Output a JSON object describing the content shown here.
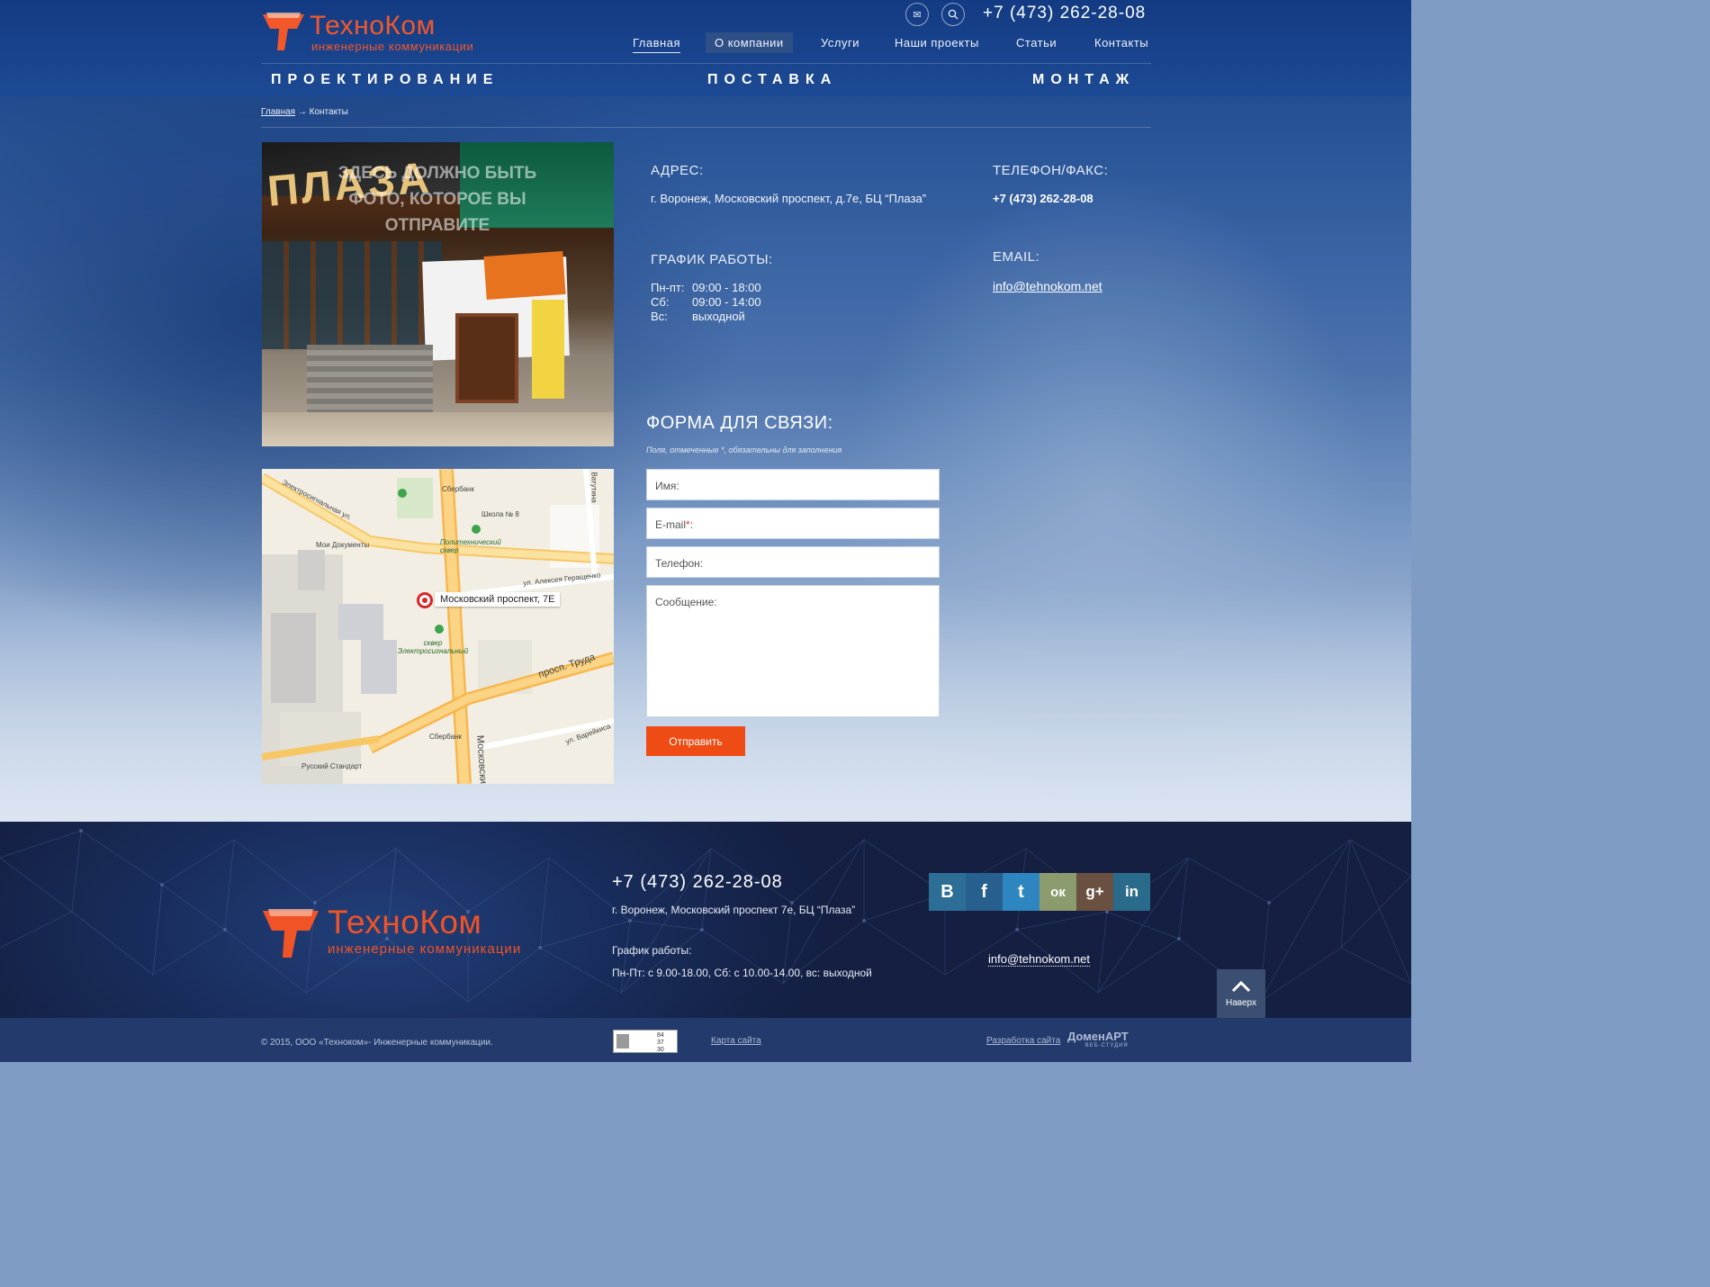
{
  "header": {
    "logo_title": "ТехноКом",
    "logo_subtitle": "инженерные коммуникации",
    "phone": "+7 (473) 262-28-08",
    "icons": {
      "mail": "mail-icon",
      "search": "search-icon"
    },
    "nav": [
      "Главная",
      "О компании",
      "Услуги",
      "Наши проекты",
      "Статьи",
      "Контакты"
    ],
    "services": [
      "ПРОЕКТИРОВАНИЕ",
      "ПОСТАВКА",
      "МОНТАЖ"
    ]
  },
  "breadcrumb": {
    "home": "Главная",
    "separator": "→",
    "current": "Контакты"
  },
  "photo": {
    "note": "ЗДЕСЬ ДОЛЖНО БЫТЬ ФОТО, КОТОРОЕ ВЫ ОТПРАВИТЕ"
  },
  "map": {
    "marker_label": "Московский проспект, 7Е",
    "labels": {
      "street1": "Электросигнальная ул.",
      "street2": "ул. Алексея Геращенко",
      "street3": "просп. Труда",
      "street4": "ул. Варейкиса",
      "street5": "Московский",
      "street6": "Ватутина",
      "poi1": "Сбербанк",
      "poi2": "Школа № 8",
      "poi3": "Мои Документы",
      "poi4": "Политехнический сквер",
      "poi5": "сквер Электросигнальный",
      "poi6": "Сбербанк",
      "poi7": "Русский Стандарт"
    }
  },
  "contacts": {
    "address_title": "АДРЕС:",
    "address": "г. Воронеж, Московский проспект, д.7е, БЦ “Плаза”",
    "phone_title": "ТЕЛЕФОН/ФАКС:",
    "phone": "+7 (473) 262-28-08",
    "hours_title": "ГРАФИК РАБОТЫ:",
    "hours": [
      {
        "day": "Пн-пт:",
        "time": "09:00 - 18:00"
      },
      {
        "day": "Сб:",
        "time": "09:00 - 14:00"
      },
      {
        "day": "Вс:",
        "time": "выходной"
      }
    ],
    "email_title": "EMAIL:",
    "email": "info@tehnokom.net"
  },
  "form": {
    "title": "ФОРМА ДЛЯ СВЯЗИ:",
    "note": "Поля, отмеченные *, обязательны для заполнения",
    "name_label": "Имя:",
    "email_label": "E-mail",
    "email_required": "*",
    "email_suffix": ":",
    "phone_label": "Телефон:",
    "message_label": "Сообщение:",
    "submit": "Отправить"
  },
  "footer": {
    "logo_title": "ТехноКом",
    "logo_subtitle": "инженерные коммуникации",
    "phone": "+7 (473) 262-28-08",
    "address": "г. Воронеж, Московский проспект 7е, БЦ “Плаза”",
    "hours_title": "График работы:",
    "hours": "Пн-Пт: с 9.00-18.00, Сб: с 10.00-14.00, вс: выходной",
    "email": "info@tehnokom.net",
    "social": [
      {
        "name": "vk-icon",
        "glyph": "В",
        "color": "#2c6e96"
      },
      {
        "name": "facebook-icon",
        "glyph": "f",
        "color": "#275f8f"
      },
      {
        "name": "twitter-icon",
        "glyph": "t",
        "color": "#2e86c0"
      },
      {
        "name": "odnoklassniki-icon",
        "glyph": "ок",
        "color": "#8b9b6d"
      },
      {
        "name": "google-plus-icon",
        "glyph": "g+",
        "color": "#6a5040"
      },
      {
        "name": "linkedin-icon",
        "glyph": "in",
        "color": "#2a6a8a"
      }
    ],
    "to_top": "Наверх"
  },
  "bottom": {
    "copyright": "© 2015, ООО «Техноком»- Инженерные коммуникации.",
    "counter": [
      "84",
      "37",
      "30"
    ],
    "sitemap": "Карта сайта",
    "dev_link": "Разработка сайта",
    "dev_name": "ДоменАРТ",
    "dev_sub": "ВЕБ-СТУДИЯ"
  }
}
